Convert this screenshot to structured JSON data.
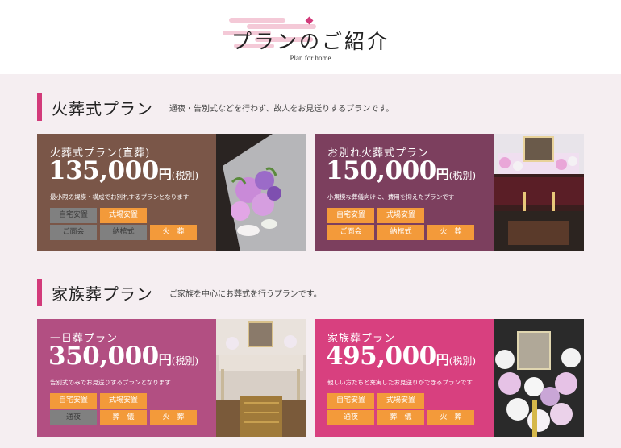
{
  "header": {
    "title": "プランのご紹介",
    "subtitle": "Plan for home"
  },
  "sections": [
    {
      "title": "火葬式プラン",
      "desc": "通夜・告別式などを行わず、故人をお見送りするプランです。",
      "cards": [
        {
          "name": "火葬式プラン(直葬)",
          "price": "135,000",
          "unit": "円",
          "tax": "(税別)",
          "desc": "最小限の規模・構成でお別れするプランとなります",
          "color": "#7a5648",
          "tags": [
            {
              "label": "自宅安置",
              "on": false
            },
            {
              "label": "式場安置",
              "on": true
            },
            {
              "label": "ご面会",
              "on": false
            },
            {
              "label": "納棺式",
              "on": false
            },
            {
              "label": "火　葬",
              "on": true
            }
          ]
        },
        {
          "name": "お別れ火葬式プラン",
          "price": "150,000",
          "unit": "円",
          "tax": "(税別)",
          "desc": "小規模な葬儀向けに、費用を抑えたプランです",
          "color": "#7c3f5e",
          "tags": [
            {
              "label": "自宅安置",
              "on": true
            },
            {
              "label": "式場安置",
              "on": true
            },
            {
              "label": "ご面会",
              "on": true
            },
            {
              "label": "納棺式",
              "on": true
            },
            {
              "label": "火　葬",
              "on": true
            }
          ]
        }
      ]
    },
    {
      "title": "家族葬プラン",
      "desc": "ご家族を中心にお葬式を行うプランです。",
      "cards": [
        {
          "name": "一日葬プラン",
          "price": "350,000",
          "unit": "円",
          "tax": "(税別)",
          "desc": "告別式のみでお見送りするプランとなります",
          "color": "#b24f82",
          "tags": [
            {
              "label": "自宅安置",
              "on": true
            },
            {
              "label": "式場安置",
              "on": true
            },
            {
              "label": "通夜",
              "on": false
            },
            {
              "label": "葬　儀",
              "on": true
            },
            {
              "label": "火　葬",
              "on": true
            }
          ]
        },
        {
          "name": "家族葬プラン",
          "price": "495,000",
          "unit": "円",
          "tax": "(税別)",
          "desc": "親しい方たちと充実したお見送りができるプランです",
          "color": "#d8407f",
          "tags": [
            {
              "label": "自宅安置",
              "on": true
            },
            {
              "label": "式場安置",
              "on": true
            },
            {
              "label": "通夜",
              "on": true
            },
            {
              "label": "葬　儀",
              "on": true
            },
            {
              "label": "火　葬",
              "on": true
            }
          ]
        }
      ]
    }
  ]
}
